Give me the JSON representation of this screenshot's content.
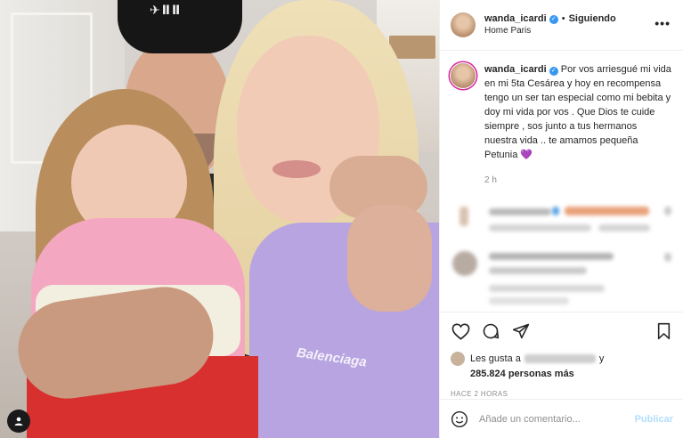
{
  "post": {
    "username": "wanda_icardi",
    "follow_label": "Siguiendo",
    "location": "Home Paris",
    "more_label": "•••"
  },
  "caption": {
    "username": "wanda_icardi",
    "text": "Por vos arriesgué mi vida en mi 5ta Cesárea y hoy en recompensa tengo un ser tan especial como mi bebita y doy mi vida por vos . Que Dios te cuide siempre , sos junto a tus hermanos nuestra vida .. te amamos pequeña Petunia",
    "emoji": "💜",
    "time": "2 h"
  },
  "photo": {
    "cap_logo": "✈ⅡⅡ",
    "sweater_brand": "Balenciaga"
  },
  "likes": {
    "prefix": "Les gusta a",
    "connector": "y",
    "count_text": "285.824 personas más"
  },
  "timestamp": "HACE 2 HORAS",
  "comment_box": {
    "placeholder": "Añade un comentario...",
    "publish_label": "Publicar"
  },
  "colors": {
    "verified": "#3897f0",
    "publish_disabled": "#b2dffc",
    "border": "#efefef",
    "secondary_text": "#8e8e8e"
  },
  "icons": [
    "heart-icon",
    "comment-icon",
    "share-icon",
    "bookmark-icon",
    "emoji-icon",
    "more-icon",
    "verified-icon",
    "user-tag-icon"
  ]
}
